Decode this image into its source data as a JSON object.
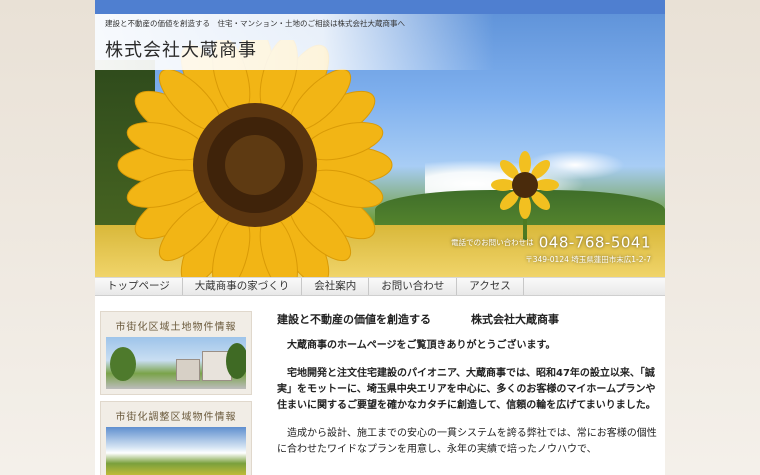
{
  "header": {
    "tagline": "建設と不動産の価値を創造する　住宅・マンション・土地のご相談は株式会社大蔵商事へ",
    "site_title": "株式会社大蔵商事",
    "contact_label": "電話でのお問い合わせは",
    "phone": "048-768-5041",
    "address": "〒349-0124 埼玉県蓮田市末広1-2-7"
  },
  "nav": {
    "items": [
      {
        "label": "トップページ"
      },
      {
        "label": "大蔵商事の家づくり"
      },
      {
        "label": "会社案内"
      },
      {
        "label": "お問い合わせ"
      },
      {
        "label": "アクセス"
      }
    ]
  },
  "sidebar": {
    "blocks": [
      {
        "title": "市街化区域土地物件情報"
      },
      {
        "title": "市街化調整区域物件情報"
      }
    ]
  },
  "main": {
    "title": "建設と不動産の価値を創造する",
    "company": "株式会社大蔵商事",
    "intro": "大蔵商事のホームページをご覧頂きありがとうございます。",
    "para1": "宅地開発と注文住宅建設のパイオニア、大蔵商事では、昭和47年の設立以来、「誠実」をモットーに、埼玉県中央エリアを中心に、多くのお客様のマイホームプランや住まいに関するご要望を確かなカタチに創造して、信頼の輪を広げてまいりました。",
    "para2": "造成から設計、施工までの安心の一貫システムを誇る弊社では、常にお客様の個性に合わせたワイドなプランを用意し、永年の実績で培ったノウハウで、"
  },
  "colors": {
    "topbar": "#4f7fd0",
    "sidebar_bg": "#f1ede6",
    "sidebar_title": "#6b5a3c"
  }
}
